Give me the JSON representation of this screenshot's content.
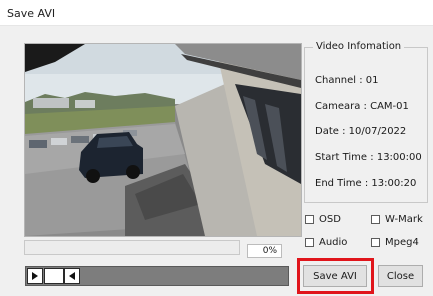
{
  "window": {
    "title": "Save AVI"
  },
  "video_info": {
    "legend": "Video Infomation",
    "channel": {
      "label": "Channel :",
      "value": "01"
    },
    "camera": {
      "label": "Cameara :",
      "value": "CAM-01"
    },
    "date": {
      "label": "Date :",
      "value": "10/07/2022"
    },
    "start_time": {
      "label": "Start Time :",
      "value": "13:00:00"
    },
    "end_time": {
      "label": "End Time :",
      "value": "13:00:20"
    }
  },
  "options": {
    "osd": {
      "label": "OSD",
      "checked": false
    },
    "wmark": {
      "label": "W-Mark",
      "checked": false
    },
    "audio": {
      "label": "Audio",
      "checked": false
    },
    "mpeg4": {
      "label": "Mpeg4",
      "checked": false
    }
  },
  "progress": {
    "percent_text": "0%",
    "fraction": 0
  },
  "buttons": {
    "save": "Save AVI",
    "close": "Close"
  },
  "icons": {
    "play": "play-icon",
    "back": "step-back-icon"
  },
  "colors": {
    "highlight": "#e0151b"
  }
}
